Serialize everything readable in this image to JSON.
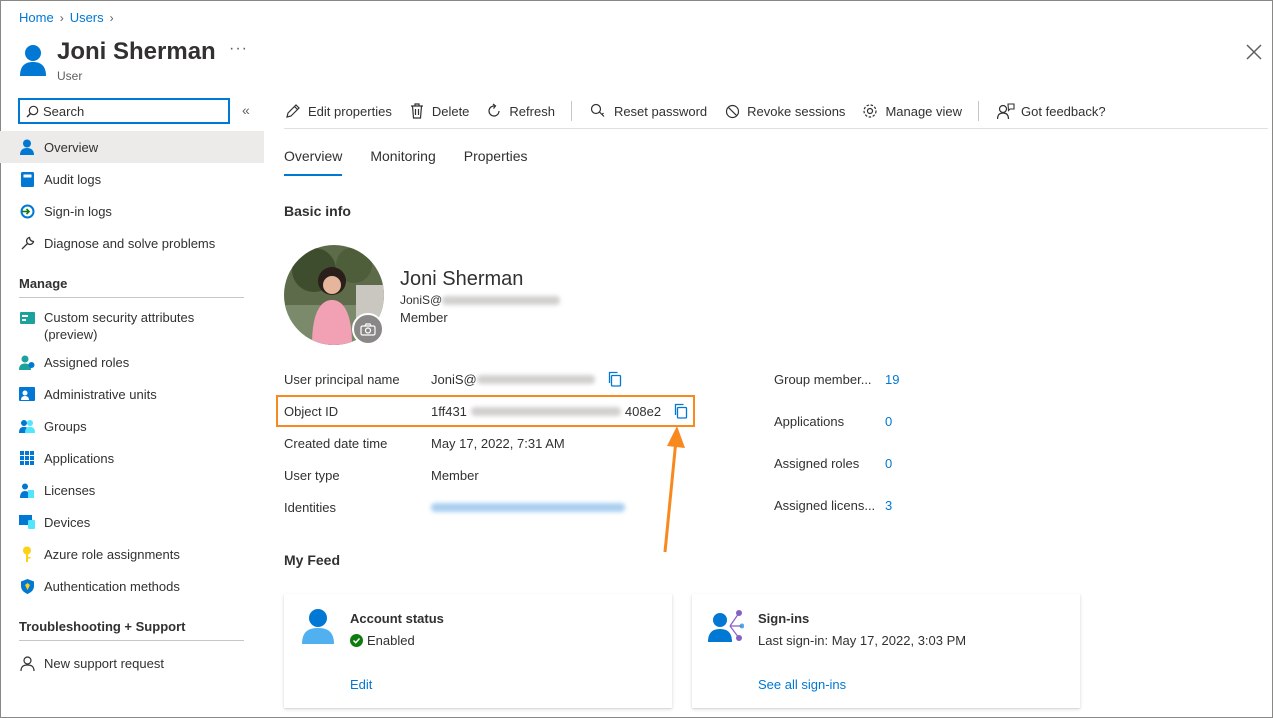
{
  "breadcrumb": [
    "Home",
    "Users"
  ],
  "header": {
    "title": "Joni Sherman",
    "subtitle": "User",
    "more": "···"
  },
  "search": {
    "placeholder": "Search"
  },
  "sidebar": {
    "top_items": [
      {
        "label": "Overview",
        "icon": "user-icon"
      },
      {
        "label": "Audit logs",
        "icon": "book-icon"
      },
      {
        "label": "Sign-in logs",
        "icon": "sign-in-icon"
      },
      {
        "label": "Diagnose and solve problems",
        "icon": "wrench-icon"
      }
    ],
    "manage_title": "Manage",
    "manage_items": [
      {
        "label": "Custom security attributes (preview)",
        "icon": "security-attributes-icon"
      },
      {
        "label": "Assigned roles",
        "icon": "roles-icon"
      },
      {
        "label": "Administrative units",
        "icon": "admin-units-icon"
      },
      {
        "label": "Groups",
        "icon": "groups-icon"
      },
      {
        "label": "Applications",
        "icon": "grid-icon"
      },
      {
        "label": "Licenses",
        "icon": "licenses-icon"
      },
      {
        "label": "Devices",
        "icon": "devices-icon"
      },
      {
        "label": "Azure role assignments",
        "icon": "key-icon"
      },
      {
        "label": "Authentication methods",
        "icon": "shield-icon"
      }
    ],
    "support_title": "Troubleshooting + Support",
    "support_items": [
      {
        "label": "New support request",
        "icon": "support-person-icon"
      }
    ]
  },
  "toolbar": {
    "edit": "Edit properties",
    "delete": "Delete",
    "refresh": "Refresh",
    "reset_password": "Reset password",
    "revoke_sessions": "Revoke sessions",
    "manage_view": "Manage view",
    "feedback": "Got feedback?"
  },
  "tabs": [
    "Overview",
    "Monitoring",
    "Properties"
  ],
  "basic_info": {
    "title": "Basic info",
    "name": "Joni Sherman",
    "email_prefix": "JoniS@",
    "role": "Member"
  },
  "properties": {
    "upn_label": "User principal name",
    "upn_prefix": "JoniS@",
    "object_id_label": "Object ID",
    "object_id_start": "1ff431",
    "object_id_end": "408e2",
    "created_label": "Created date time",
    "created_value": "May 17, 2022, 7:31 AM",
    "user_type_label": "User type",
    "user_type_value": "Member",
    "identities_label": "Identities"
  },
  "stats": [
    {
      "label": "Group member...",
      "value": "19"
    },
    {
      "label": "Applications",
      "value": "0"
    },
    {
      "label": "Assigned roles",
      "value": "0"
    },
    {
      "label": "Assigned licens...",
      "value": "3"
    }
  ],
  "feed": {
    "title": "My Feed",
    "account": {
      "title": "Account status",
      "status": "Enabled",
      "link": "Edit"
    },
    "signins": {
      "title": "Sign-ins",
      "last": "Last sign-in: May 17, 2022, 3:03 PM",
      "link": "See all sign-ins"
    }
  },
  "colors": {
    "accent": "#0078d4",
    "highlight": "#f7891f",
    "success": "#107c10"
  }
}
